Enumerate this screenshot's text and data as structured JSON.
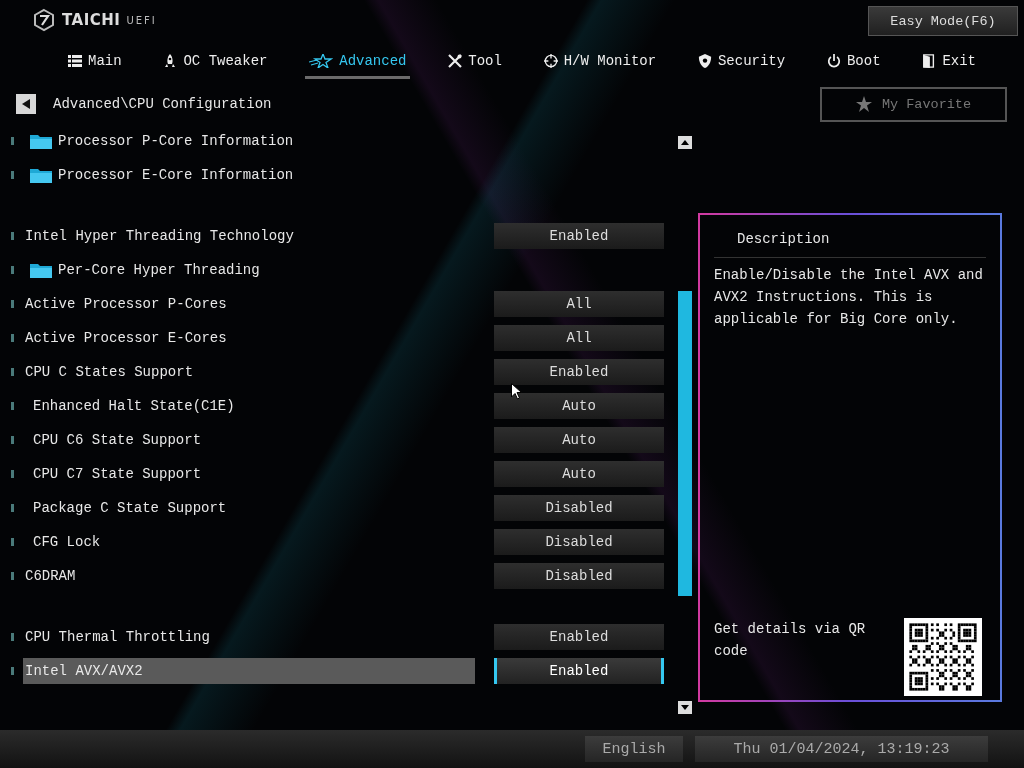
{
  "logo": {
    "name": "TAICHI",
    "suffix": "UEFI"
  },
  "easy_mode_button": "Easy Mode(F6)",
  "tabs": [
    {
      "label": "Main",
      "selected": false
    },
    {
      "label": "OC Tweaker",
      "selected": false
    },
    {
      "label": "Advanced",
      "selected": true
    },
    {
      "label": "Tool",
      "selected": false
    },
    {
      "label": "H/W Monitor",
      "selected": false
    },
    {
      "label": "Security",
      "selected": false
    },
    {
      "label": "Boot",
      "selected": false
    },
    {
      "label": "Exit",
      "selected": false
    }
  ],
  "breadcrumb": "Advanced\\CPU Configuration",
  "favorite_button": "My Favorite",
  "groups": [
    [
      {
        "kind": "folder",
        "label": "Processor P-Core Information",
        "selected": false
      },
      {
        "kind": "folder",
        "label": "Processor E-Core Information",
        "selected": false
      }
    ],
    [
      {
        "kind": "setting",
        "label": "Intel Hyper Threading Technology",
        "value": "Enabled",
        "selected": false
      },
      {
        "kind": "folder",
        "label": "Per-Core Hyper Threading",
        "selected": false
      },
      {
        "kind": "setting",
        "label": "Active Processor P-Cores",
        "value": "All",
        "selected": false
      },
      {
        "kind": "setting",
        "label": "Active Processor E-Cores",
        "value": "All",
        "selected": false
      },
      {
        "kind": "setting",
        "label": "CPU C States Support",
        "value": "Enabled",
        "selected": false,
        "children": [
          {
            "kind": "setting",
            "label": "Enhanced Halt State(C1E)",
            "value": "Auto",
            "selected": false
          },
          {
            "kind": "setting",
            "label": "CPU C6 State Support",
            "value": "Auto",
            "selected": false
          },
          {
            "kind": "setting",
            "label": "CPU C7 State Support",
            "value": "Auto",
            "selected": false
          },
          {
            "kind": "setting",
            "label": "Package C State Support",
            "value": "Disabled",
            "selected": false
          },
          {
            "kind": "setting",
            "label": "CFG Lock",
            "value": "Disabled",
            "selected": false
          }
        ]
      },
      {
        "kind": "setting",
        "label": "C6DRAM",
        "value": "Disabled",
        "selected": false
      }
    ],
    [
      {
        "kind": "setting",
        "label": "CPU Thermal Throttling",
        "value": "Enabled",
        "selected": false
      },
      {
        "kind": "setting",
        "label": "Intel AVX/AVX2",
        "value": "Enabled",
        "selected": true
      }
    ]
  ],
  "description": {
    "title": "Description",
    "text": "Enable/Disable the Intel AVX and AVX2 Instructions. This is applicable for Big Core only.",
    "qr_hint": "Get details via QR code"
  },
  "status_bar": {
    "language": "English",
    "datetime": "Thu 01/04/2024, 13:19:23"
  }
}
